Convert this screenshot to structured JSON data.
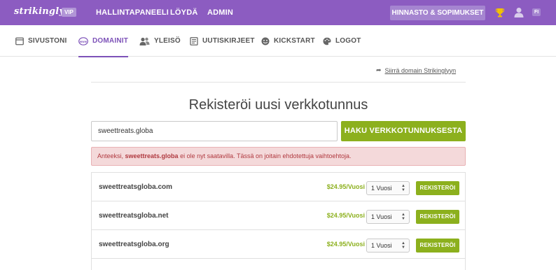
{
  "topbar": {
    "logo": "strikingly",
    "vip_badge": "VIP",
    "nav": [
      "HALLINTAPANEELI",
      "LÖYDÄ",
      "ADMIN"
    ],
    "pricing_button": "HINNASTO & SOPIMUKSET",
    "language": "FI"
  },
  "subnav": {
    "items": [
      {
        "label": "SIVUSTONI",
        "icon": "browser-window-icon"
      },
      {
        "label": "DOMAINIT",
        "icon": "www-globe-icon"
      },
      {
        "label": "YLEISÖ",
        "icon": "people-icon"
      },
      {
        "label": "UUTISKIRJEET",
        "icon": "newsletter-icon"
      },
      {
        "label": "KICKSTART",
        "icon": "smiley-icon"
      },
      {
        "label": "LOGOT",
        "icon": "logo-palette-icon"
      }
    ],
    "active": "DOMAINIT"
  },
  "transfer_link": "Siirrä domain Strikinglyyn",
  "heading": "Rekisteröi uusi verkkotunnus",
  "search": {
    "value": "sweettreats.globa",
    "button": "HAKU VERKKOTUNNUKSESTA"
  },
  "alert": {
    "prefix": "Anteeksi, ",
    "domain": "sweettreats.globa",
    "suffix": " ei ole nyt saatavilla. Tässä on joitain ehdotettuja vaihtoehtoja."
  },
  "results": [
    {
      "domain": "sweettreatsgloba.com",
      "price": "$24.95/Vuosi",
      "period": "1 Vuosi",
      "button": "REKISTERÖI"
    },
    {
      "domain": "sweettreatsgloba.net",
      "price": "$24.95/Vuosi",
      "period": "1 Vuosi",
      "button": "REKISTERÖI"
    },
    {
      "domain": "sweettreatsgloba.org",
      "price": "$24.95/Vuosi",
      "period": "1 Vuosi",
      "button": "REKISTERÖI"
    }
  ],
  "colors": {
    "topbar": "#8c5cc1",
    "accent_green": "#8cb01d",
    "active_purple": "#7d52b8",
    "alert_text": "#b03a40"
  }
}
